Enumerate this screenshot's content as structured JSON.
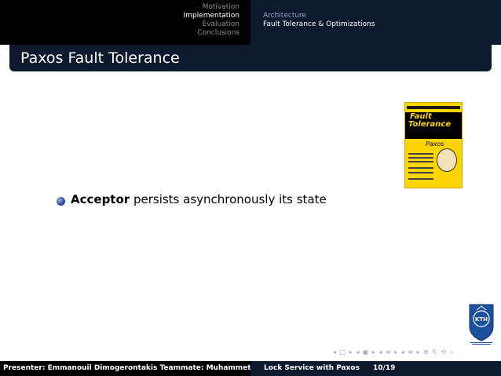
{
  "nav": {
    "sections": [
      "Motivation",
      "Implementation",
      "Evaluation",
      "Conclusions"
    ],
    "active_section": "Implementation",
    "subsections": [
      "Architecture",
      "Fault Tolerance & Optimizations"
    ],
    "active_subsection": "Fault Tolerance & Optimizations"
  },
  "frame": {
    "title": "Paxos Fault Tolerance"
  },
  "book_cover": {
    "title_line1": "Fault",
    "title_line2": "Tolerance",
    "subtitle": "Paxos"
  },
  "content": {
    "item_bold": "Acceptor",
    "item_rest": " persists asynchronously its state"
  },
  "logo": {
    "label": "KTH"
  },
  "footer": {
    "presenter": "Presenter: Emmanouil Dimogerontakis Teammate: Muhammet",
    "short_title": "Lock Service with Paxos",
    "page": "10/19"
  },
  "colors": {
    "header_dark": "#000000",
    "header_navy": "#0d1a2e",
    "inactive_text": "#8c8c8c",
    "bullet": "#2d4fa3",
    "book_yellow": "#ffd400"
  }
}
